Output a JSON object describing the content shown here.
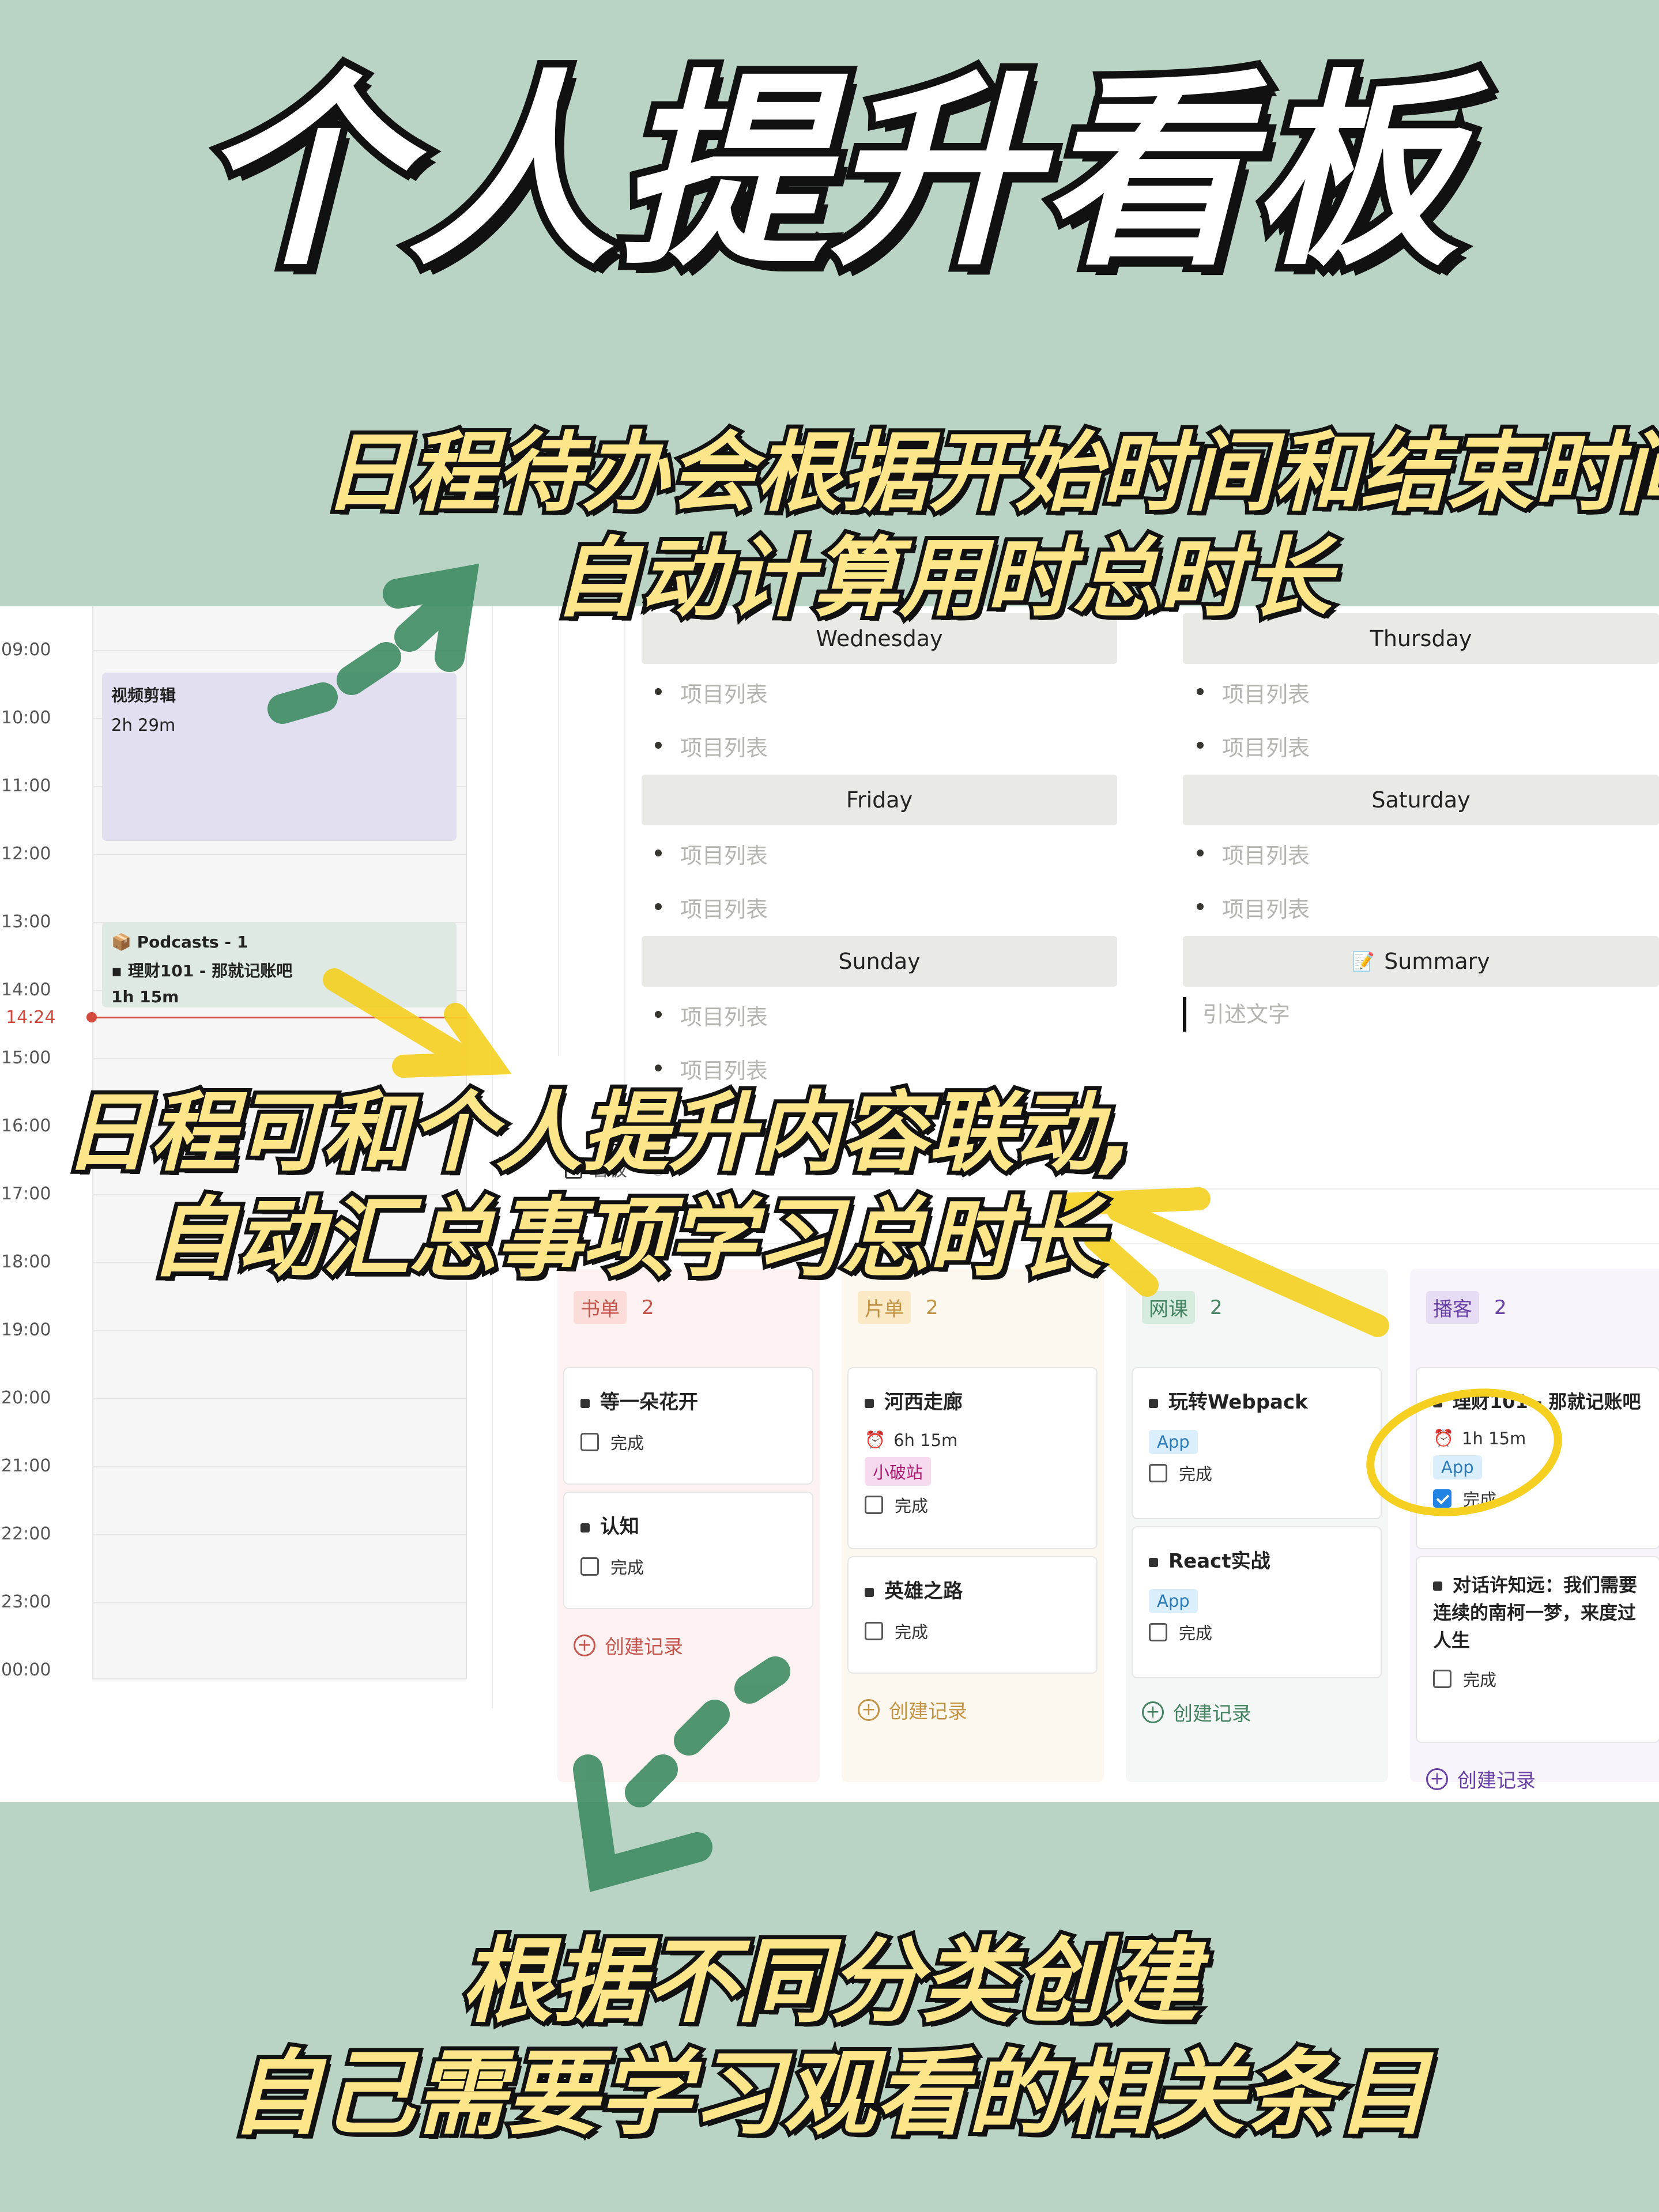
{
  "headline": "个人提升看板",
  "caption1": {
    "line1": "日程待办会根据开始时间和结束时间",
    "line2": "自动计算用时总时长"
  },
  "caption2": {
    "line1": "日程可和个人提升内容联动,",
    "line2": "自动汇总事项学习总时长"
  },
  "caption3": {
    "line1": "根据不同分类创建",
    "line2": "自己需要学习观看的相关条目"
  },
  "calendar": {
    "hours": [
      "09:00",
      "10:00",
      "11:00",
      "12:00",
      "13:00",
      "14:00",
      "15:00",
      "16:00",
      "17:00",
      "18:00",
      "19:00",
      "20:00",
      "21:00",
      "22:00",
      "23:00",
      "00:00"
    ],
    "now": "14:24",
    "event1": {
      "title": "视频剪辑",
      "duration": "2h 29m"
    },
    "event2": {
      "line1": "Podcasts - 1",
      "line2": "理财101 - 那就记账吧",
      "line3": "1h 15m"
    }
  },
  "week": {
    "wednesday": "Wednesday",
    "thursday": "Thursday",
    "friday": "Friday",
    "saturday": "Saturday",
    "sunday": "Sunday",
    "summary": "Summary",
    "placeholder": "项目列表",
    "quote": "引述文字"
  },
  "kanban_tab": "看板",
  "kanban": {
    "new_label": "创建记录",
    "done_label": "完成",
    "columns": [
      {
        "name": "书单",
        "count": "2",
        "color": "#c4554d",
        "bg": "#fdf2f1",
        "tagbg": "#fbdcd8",
        "cards": [
          {
            "title": "等一朵花开"
          },
          {
            "title": "认知"
          }
        ]
      },
      {
        "name": "片单",
        "count": "2",
        "color": "#c29343",
        "bg": "#fdf8ef",
        "tagbg": "#fbe8c4",
        "cards": [
          {
            "title": "河西走廊",
            "time": "6h 15m",
            "tag": "小破站"
          },
          {
            "title": "英雄之路"
          }
        ]
      },
      {
        "name": "网课",
        "count": "2",
        "color": "#448361",
        "bg": "#f4f7f5",
        "tagbg": "#d7ebdf",
        "cards": [
          {
            "title": "玩转Webpack",
            "tag": "App"
          },
          {
            "title": "React实战",
            "tag": "App"
          }
        ]
      },
      {
        "name": "播客",
        "count": "2",
        "color": "#6940a5",
        "bg": "#f7f4fb",
        "tagbg": "#e6dcf3",
        "cards": [
          {
            "title": "理财101 - 那就记账吧",
            "time": "1h 15m",
            "tag": "App"
          },
          {
            "title": "对话许知远：我们需要连续的南柯一梦，来度过人生"
          }
        ]
      }
    ]
  }
}
